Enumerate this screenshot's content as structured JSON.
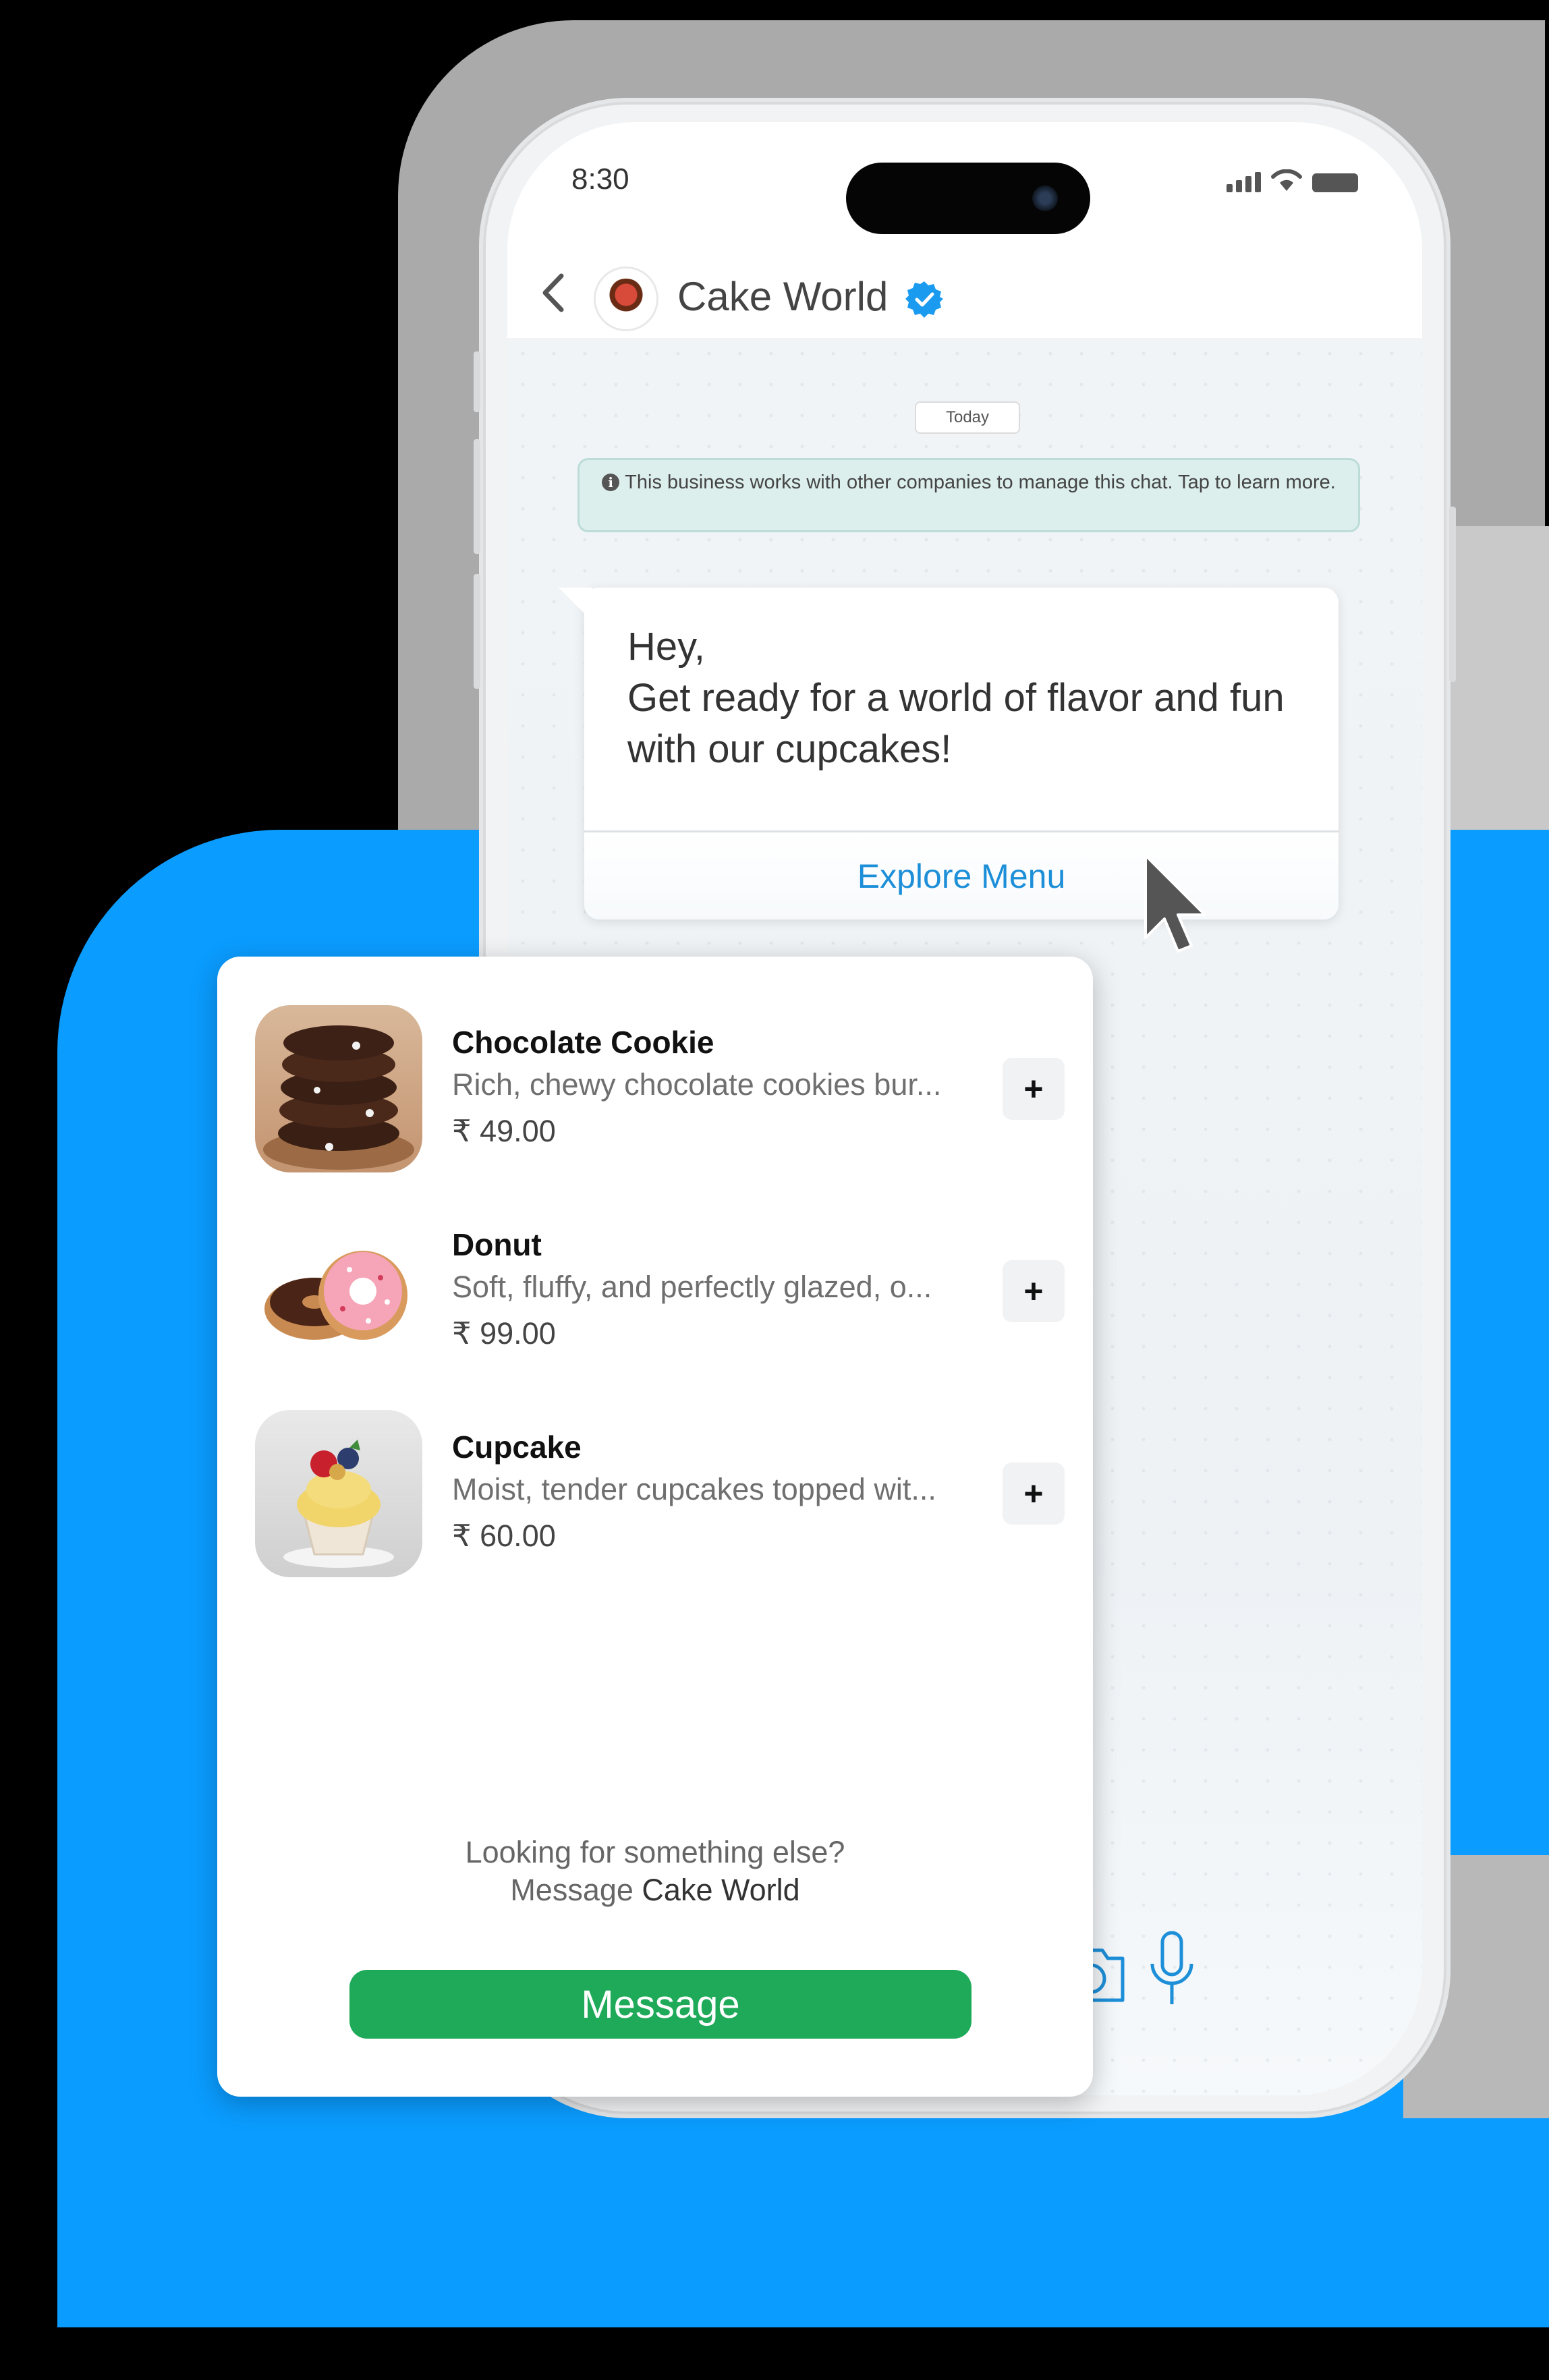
{
  "status_bar": {
    "time": "8:30"
  },
  "header": {
    "title": "Cake World"
  },
  "chat": {
    "date_chip": "Today",
    "notice": "This business works with other companies to manage this chat. Tap to learn more.",
    "message_line1": "Hey,",
    "message_line2": "Get ready for a world of flavor and fun with our cupcakes!",
    "button_label": "Explore Menu"
  },
  "menu": {
    "items": [
      {
        "name": "Chocolate Cookie",
        "description": "Rich, chewy chocolate cookies bur...",
        "price": "₹ 49.00",
        "add_label": "+"
      },
      {
        "name": "Donut",
        "description": "Soft, fluffy, and perfectly glazed, o...",
        "price": "₹ 99.00",
        "add_label": "+"
      },
      {
        "name": "Cupcake",
        "description": "Moist, tender cupcakes topped wit...",
        "price": "₹ 60.00",
        "add_label": "+"
      }
    ],
    "footer_line1": "Looking for something else?",
    "footer_prefix": "Message ",
    "footer_business": "Cake World",
    "message_button": "Message"
  },
  "colors": {
    "accent_blue": "#0a9cff",
    "link_blue": "#1d8fd8",
    "verified_blue": "#1a9bf0",
    "message_green": "#1faa59"
  },
  "icons": [
    "back-chevron-icon",
    "verified-badge-icon",
    "info-icon",
    "signal-icon",
    "wifi-icon",
    "battery-icon",
    "camera-icon",
    "microphone-icon",
    "mouse-cursor-icon"
  ]
}
